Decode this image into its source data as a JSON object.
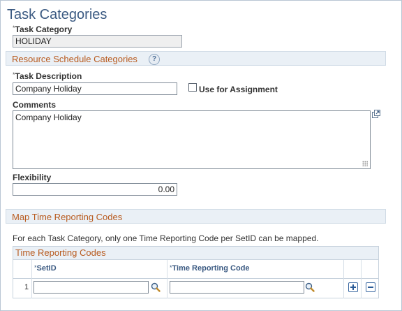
{
  "page": {
    "title": "Task Categories"
  },
  "task_category": {
    "label": "Task Category",
    "required_mark": "*",
    "value": "HOLIDAY"
  },
  "resource_section": {
    "title": "Resource Schedule Categories",
    "help_icon": "question-mark-icon",
    "help_text": "?"
  },
  "task_description": {
    "label": "Task Description",
    "required_mark": "*",
    "value": "Company Holiday"
  },
  "use_for_assignment": {
    "label": "Use for Assignment",
    "checked": false
  },
  "comments": {
    "label": "Comments",
    "value": "Company Holiday",
    "expand_icon": "expand-window-icon"
  },
  "flexibility": {
    "label": "Flexibility",
    "value": "0.00"
  },
  "map_section": {
    "title": "Map Time Reporting Codes"
  },
  "info": {
    "text": "For each Task Category, only one Time Reporting Code per SetID can be mapped."
  },
  "grid": {
    "caption": "Time Reporting Codes",
    "columns": [
      {
        "label": "SetID",
        "required_mark": "*"
      },
      {
        "label": "Time Reporting Code",
        "required_mark": "*"
      }
    ],
    "rows": [
      {
        "number": "1",
        "setid": "",
        "time_reporting_code": ""
      }
    ],
    "add_icon": "plus-icon",
    "delete_icon": "minus-icon",
    "lookup_icon": "magnifier-icon"
  },
  "colors": {
    "title": "#3b5a82",
    "section_title": "#b85a1e",
    "section_bg": "#eaf0f6"
  }
}
